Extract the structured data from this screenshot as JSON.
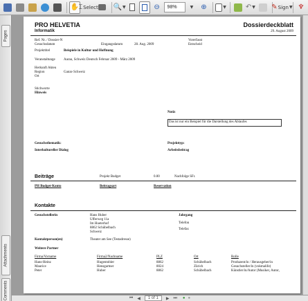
{
  "toolbar": {
    "select_label": "Select",
    "zoom_value": "98%",
    "sign_label": "Sign"
  },
  "nav": {
    "tab_pages": "Pages",
    "tab_attachments": "Attachments",
    "tab_comments": "Comments"
  },
  "status": {
    "page_indicator": "1 of 1"
  },
  "doc": {
    "org": "PRO HELVETIA",
    "dept": "Informatik",
    "title": "Dossierdeckblatt",
    "date": "29. August 2009",
    "ref_label": "Ref. Nr. / Dossier-N",
    "gesuchsdatum_label": "Gesuchsdatum",
    "eingangsdatum_label": "Eingangsdatum",
    "eingangsdatum_value": "28. Aug. 2009",
    "vorerfasst_label": "Vorerfasst",
    "entscheid_label": "Entscheid",
    "projekttitel_label": "Projekttitel",
    "projekttitel_value": "Beispiele in Kultur und Hoffnung",
    "veranstaltunge_label": "Veranstaltunge",
    "veranstaltunge_value": "Aarau, Schweiz Deutsch   Februar 2009 - März 2009",
    "herkunft_label": "Herkunft Akteu",
    "region_label": "Region",
    "region_value": "Ganze Schweiz",
    "ort_label": "Ort",
    "stichworte_label": "Stichworte",
    "hinweis_label": "Hinweis",
    "notiz_label": "Notiz",
    "notiz_value": "Das ist nur ein Beispiel für die Darstellung des Ablaufes",
    "gesuchsthematik_label": "Gesuchsthematik:",
    "projekttyp_label": "Projekttyp:",
    "interkultureller_label": "Interkultureller Dialog",
    "arbeitsbeitrag_label": "Arbeitsbeitrag",
    "beitraege_heading": "Beiträge",
    "projekt_budget_label": "Projekt Budget",
    "budget_value": "0.00",
    "nachfolge_label": "Nachfolge SFr.",
    "ph_budget_label": "PH Budget-Konto",
    "beitragsart_label": "Beitragsart",
    "reservation_label": "Reservation",
    "kontakte_heading": "Kontakte",
    "gesuchstellerin_label": "Gesuchstellerin",
    "gesuchstellerin_lines": [
      "Hans Huber",
      "Ufferweg 11a",
      "Im Hueterhof",
      "8862 Schübelbach",
      "Schweiz"
    ],
    "jahrgang_label": "Jahrgang",
    "telefon_label": "Telefon",
    "telefax_label": "Telefax",
    "kontaktperson_label": "Kontaktperson(en)",
    "kontaktperson_value": "Theater am See (Testadresse)",
    "partner_heading": "Weitere Partner",
    "partner_headers": [
      "Firma/Vorname",
      "Firma2/Nachname",
      "PLZ",
      "Ort",
      "Rolle"
    ],
    "partner_rows": [
      [
        "Hans-Heinz",
        "Hugentobler",
        "8862",
        "Schübelbach",
        "Produzent/in / Herausgeber/in"
      ],
      [
        "Maurice",
        "Hensgartner",
        "8024",
        "Zürich",
        "Gesuchsteller/in (vokmalife)"
      ],
      [
        "Peter",
        "Huber",
        "8862",
        "Schübelbach",
        "Künstler/in/Autor (Musiker, Autor,"
      ]
    ]
  }
}
